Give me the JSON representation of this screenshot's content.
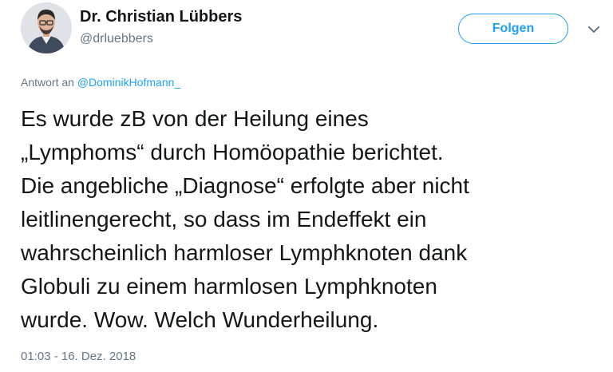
{
  "author": {
    "display_name": "Dr. Christian Lübbers",
    "handle": "@drluebbers"
  },
  "follow_button": {
    "label": "Folgen"
  },
  "reply_context": {
    "prefix": "Antwort an",
    "mention": "@DominikHofmann_"
  },
  "tweet": {
    "lines": [
      "Es wurde zB von der Heilung eines",
      "„Lymphoms“ durch Homöopathie berichtet.",
      "Die angebliche „Diagnose“ erfolgte aber nicht",
      "leitlinengerecht, so dass im Endeffekt ein",
      "wahrscheinlich harmloser Lymphknoten dank",
      "Globuli zu einem harmlosen Lymphknoten",
      "wurde. Wow. Welch Wunderheilung."
    ],
    "timestamp": "01:03 - 16. Dez. 2018"
  },
  "icons": {
    "avatar": "avatar-photo",
    "menu": "chevron-down-icon"
  },
  "colors": {
    "accent": "#1da1f2",
    "text": "#14171a",
    "muted": "#657786"
  }
}
